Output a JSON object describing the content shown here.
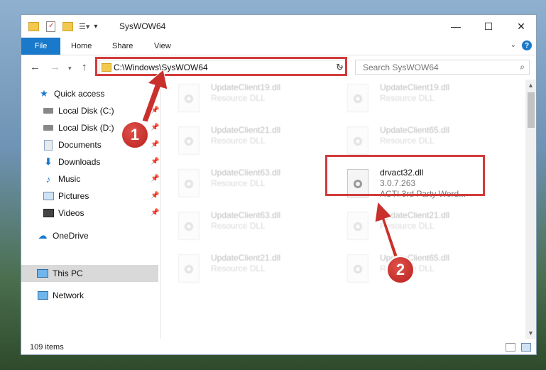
{
  "window": {
    "title": "SysWOW64",
    "minimize": "—",
    "maximize": "☐",
    "close": "✕"
  },
  "ribbon": {
    "file": "File",
    "home": "Home",
    "share": "Share",
    "view": "View",
    "help": "?"
  },
  "address": {
    "path": "C:\\Windows\\SysWOW64"
  },
  "search": {
    "placeholder": "Search SysWOW64"
  },
  "sidebar": {
    "items": [
      {
        "label": "Quick access",
        "icon": "star-icon"
      },
      {
        "label": "Local Disk (C:)",
        "icon": "drive-icon"
      },
      {
        "label": "Local Disk (D:)",
        "icon": "drive-icon"
      },
      {
        "label": "Documents",
        "icon": "documents-icon"
      },
      {
        "label": "Downloads",
        "icon": "download-icon"
      },
      {
        "label": "Music",
        "icon": "music-icon"
      },
      {
        "label": "Pictures",
        "icon": "pictures-icon"
      },
      {
        "label": "Videos",
        "icon": "videos-icon"
      },
      {
        "label": "OneDrive",
        "icon": "cloud-icon"
      },
      {
        "label": "This PC",
        "icon": "computer-icon"
      },
      {
        "label": "Network",
        "icon": "network-icon"
      }
    ]
  },
  "files": [
    {
      "name": "UpdateClient19.dll",
      "type": "Resource DLL"
    },
    {
      "name": "UpdateClient19.dll",
      "type": "Resource DLL"
    },
    {
      "name": "UpdateClient21.dll",
      "type": "Resource DLL"
    },
    {
      "name": "UpdateClient65.dll",
      "type": "Resource DLL"
    },
    {
      "name": "UpdateClient63.dll",
      "type": "Resource DLL"
    },
    {
      "name": "drvact32.dll",
      "version": "3.0.7.263",
      "type": "ACT! 3rd Party Word..."
    },
    {
      "name": "UpdateClient63.dll",
      "type": "Resource DLL"
    },
    {
      "name": "UpdateClient21.dll",
      "type": "Resource DLL"
    },
    {
      "name": "UpdateClient21.dll",
      "type": "Resource DLL"
    },
    {
      "name": "UpdateClient65.dll",
      "type": "Resource DLL"
    }
  ],
  "status": {
    "items_count": "109 items"
  },
  "callouts": {
    "one": "1",
    "two": "2"
  },
  "colors": {
    "accent": "#1979ca",
    "highlight": "#d23b3b",
    "callout": "#c9302c"
  }
}
